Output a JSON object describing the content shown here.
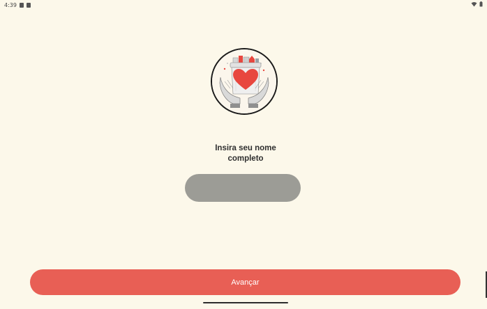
{
  "status_bar": {
    "time": "4:39",
    "left_icons": [
      "notification-icon",
      "sim-icon"
    ],
    "right_icons": [
      "wifi-icon",
      "battery-icon"
    ]
  },
  "logo": {
    "icon": "hands-holding-heart-gift-bag-icon",
    "colors": {
      "heart": "#e8473f",
      "hands": "#d9d9d9",
      "border": "#1a1a1a"
    }
  },
  "form": {
    "prompt_line1": "Insira seu nome",
    "prompt_line2": "completo",
    "name_value": "",
    "name_placeholder": ""
  },
  "actions": {
    "next_label": "Avançar"
  },
  "colors": {
    "background": "#fcf8ea",
    "accent": "#e85f55",
    "input_fill": "#9c9c96"
  }
}
